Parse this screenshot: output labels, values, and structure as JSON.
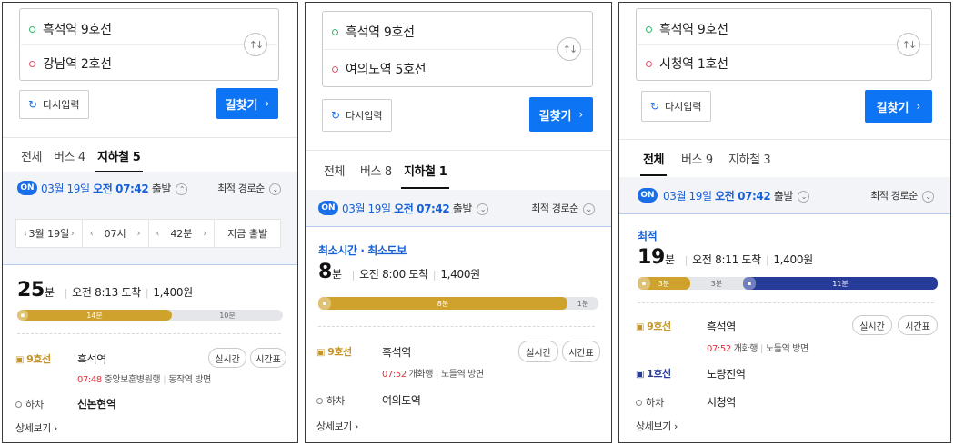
{
  "panels": [
    {
      "origin": "흑석역 9호선",
      "destination": "강남역 2호선",
      "reset_label": "다시입력",
      "search_label": "길찾기",
      "tabs": [
        "전체",
        "버스 4",
        "지하철 5"
      ],
      "departure": {
        "on": "ON",
        "date": "03월 19일",
        "time": "오전 07:42",
        "suffix": "출발",
        "toggle": "^"
      },
      "sort_label": "최적 경로순",
      "time_picker": {
        "date": "3월 19일",
        "hour": "07시",
        "minute": "42분",
        "now": "지금 출발"
      },
      "route": {
        "label": "",
        "minutes": "25",
        "unit": "분",
        "arrival": "오전 8:13 도착",
        "fare": "1,400원",
        "segments": [
          {
            "label": "14분",
            "minutes": 14,
            "color": "#cfa22d"
          },
          {
            "label": "10분",
            "minutes": 10,
            "color": "rest"
          }
        ],
        "legs": [
          {
            "line": "9호선",
            "station": "흑석역",
            "time": "07:48",
            "train": "중앙보훈병원행",
            "direction": "동작역 방면",
            "realtime": "실시간",
            "timetable": "시간표"
          }
        ],
        "alight_label": "하차",
        "alight_station": "신논현역",
        "detail_label": "상세보기"
      }
    },
    {
      "origin": "흑석역 9호선",
      "destination": "여의도역 5호선",
      "reset_label": "다시입력",
      "search_label": "길찾기",
      "tabs": [
        "전체",
        "버스 8",
        "지하철 1"
      ],
      "departure": {
        "on": "ON",
        "date": "03월 19일",
        "time": "오전 07:42",
        "suffix": "출발",
        "toggle": "v"
      },
      "sort_label": "최적 경로순",
      "route": {
        "label": "최소시간 · 최소도보",
        "minutes": "8",
        "unit": "분",
        "arrival": "오전 8:00 도착",
        "fare": "1,400원",
        "segments": [
          {
            "label": "8분",
            "minutes": 8,
            "color": "#cfa22d"
          },
          {
            "label": "1분",
            "minutes": 1,
            "color": "rest"
          }
        ],
        "legs": [
          {
            "line": "9호선",
            "station": "흑석역",
            "time": "07:52",
            "train": "개화행",
            "direction": "노들역 방면",
            "realtime": "실시간",
            "timetable": "시간표"
          }
        ],
        "alight_label": "하차",
        "alight_station": "여의도역",
        "detail_label": "상세보기"
      }
    },
    {
      "origin": "흑석역 9호선",
      "destination": "시청역 1호선",
      "reset_label": "다시입력",
      "search_label": "길찾기",
      "tabs": [
        "전체",
        "버스 9",
        "지하철 3"
      ],
      "departure": {
        "on": "ON",
        "date": "03월 19일",
        "time": "오전 07:42",
        "suffix": "출발",
        "toggle": "v"
      },
      "sort_label": "최적 경로순",
      "route": {
        "label": "최적",
        "minutes": "19",
        "unit": "분",
        "arrival": "오전 8:11 도착",
        "fare": "1,400원",
        "segments": [
          {
            "label": "3분",
            "minutes": 3,
            "color": "#cfa22d"
          },
          {
            "label": "3분",
            "minutes": 3,
            "color": "rest"
          },
          {
            "label": "11분",
            "minutes": 11,
            "color": "#263c98"
          }
        ],
        "legs": [
          {
            "line": "9호선",
            "station": "흑석역",
            "time": "07:52",
            "train": "개화행",
            "direction": "노들역 방면",
            "realtime": "실시간",
            "timetable": "시간표"
          },
          {
            "line": "1호선",
            "station": "노량진역"
          }
        ],
        "alight_label": "하차",
        "alight_station": "시청역",
        "detail_label": "상세보기"
      }
    }
  ]
}
